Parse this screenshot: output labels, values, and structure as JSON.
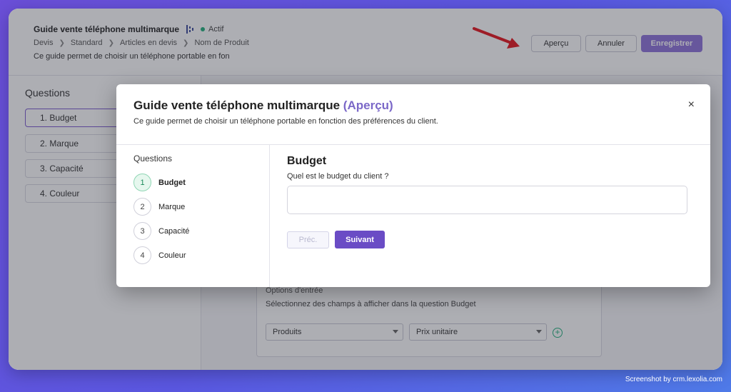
{
  "app": {
    "title": "Guide vente téléphone multimarque",
    "status": "Actif",
    "breadcrumb": [
      "Devis",
      "Standard",
      "Articles en devis",
      "Nom de Produit"
    ],
    "description": "Ce guide permet de choisir un téléphone portable en fon",
    "buttons": {
      "apercu": "Aperçu",
      "annuler": "Annuler",
      "enregistrer": "Enregistrer"
    }
  },
  "left_panel": {
    "title": "Questions",
    "items": [
      "1. Budget",
      "2. Marque",
      "3. Capacité",
      "4. Couleur"
    ]
  },
  "options": {
    "title": "Options d'entrée",
    "subtitle": "Sélectionnez des champs à afficher dans la question Budget",
    "select1": "Produits",
    "select2": "Prix unitaire"
  },
  "modal": {
    "title": "Guide vente téléphone multimarque",
    "title_suffix": "(Aperçu)",
    "description": "Ce guide permet de choisir un téléphone portable en fonction des préférences du client.",
    "close": "×",
    "sidebar_title": "Questions",
    "steps": [
      {
        "num": "1",
        "label": "Budget"
      },
      {
        "num": "2",
        "label": "Marque"
      },
      {
        "num": "3",
        "label": "Capacité"
      },
      {
        "num": "4",
        "label": "Couleur"
      }
    ],
    "question_title": "Budget",
    "question_text": "Quel est le budget du client ?",
    "input_value": "",
    "prev_label": "Préc.",
    "next_label": "Suivant"
  },
  "footer": "Screenshot by crm.lexolia.com",
  "colors": {
    "accent": "#6a4cc5",
    "status": "#22b07d",
    "arrow": "#e5141c"
  }
}
